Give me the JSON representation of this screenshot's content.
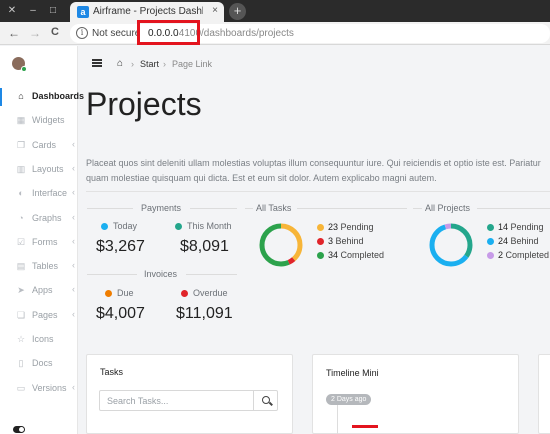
{
  "browser": {
    "tab_favicon": "a",
    "tab_title": "Airframe - Projects Dashb",
    "tab_close": "×",
    "new_tab": "+",
    "nav_back": "←",
    "nav_forward": "→",
    "nav_reload": "C",
    "info_icon": "i",
    "security": "Not secure",
    "url_host": "0.0.0.0",
    "url_path": ":4100/dashboards/projects"
  },
  "sidebar": {
    "items": [
      {
        "label": "Dashboards",
        "icon": "home-icon",
        "glyph": "⌂",
        "active": true
      },
      {
        "label": "Widgets",
        "icon": "grid-icon",
        "glyph": "▦",
        "chevron": false
      },
      {
        "label": "Cards",
        "icon": "clone-icon",
        "glyph": "❐",
        "chevron": true
      },
      {
        "label": "Layouts",
        "icon": "columns-icon",
        "glyph": "▥",
        "chevron": true
      },
      {
        "label": "Interface",
        "icon": "toggle-icon",
        "glyph": "◐",
        "chevron": true
      },
      {
        "label": "Graphs",
        "icon": "pie-icon",
        "glyph": "◔",
        "chevron": true
      },
      {
        "label": "Forms",
        "icon": "check-square-icon",
        "glyph": "☑",
        "chevron": true
      },
      {
        "label": "Tables",
        "icon": "table-icon",
        "glyph": "▤",
        "chevron": true
      },
      {
        "label": "Apps",
        "icon": "pointer-icon",
        "glyph": "➤",
        "chevron": true
      },
      {
        "label": "Pages",
        "icon": "copy-icon",
        "glyph": "❏",
        "chevron": true
      },
      {
        "label": "Icons",
        "icon": "star-icon",
        "glyph": "☆",
        "chevron": false
      },
      {
        "label": "Docs",
        "icon": "file-icon",
        "glyph": "▯",
        "chevron": false
      },
      {
        "label": "Versions",
        "icon": "folder-icon",
        "glyph": "▭",
        "chevron": true
      }
    ],
    "chevron_glyph": "‹"
  },
  "breadcrumb": {
    "home_glyph": "⌂",
    "sep": "›",
    "start": "Start",
    "page_link": "Page Link"
  },
  "page": {
    "title": "Projects",
    "description": "Placeat quos sint deleniti ullam molestias voluptas illum consequuntur iure. Qui reiciendis et optio iste est. Pariatur quam molestiae quisquam qui dicta. Est et eum sit dolor. Autem explicabo magni autem."
  },
  "payments": {
    "heading": "Payments",
    "today_label": "Today",
    "today_value": "$3,267",
    "month_label": "This Month",
    "month_value": "$8,091"
  },
  "invoices": {
    "heading": "Invoices",
    "due_label": "Due",
    "due_value": "$4,007",
    "overdue_label": "Overdue",
    "overdue_value": "$11,091"
  },
  "all_tasks": {
    "heading": "All Tasks",
    "legend": [
      {
        "count": "23",
        "label": "Pending",
        "color": "#f7b538"
      },
      {
        "count": "3",
        "label": "Behind",
        "color": "#e0242a"
      },
      {
        "count": "34",
        "label": "Completed",
        "color": "#2ca24c"
      }
    ]
  },
  "all_projects": {
    "heading": "All Projects",
    "legend": [
      {
        "count": "14",
        "label": "Pending",
        "color": "#24a68c"
      },
      {
        "count": "24",
        "label": "Behind",
        "color": "#1aaff0"
      },
      {
        "count": "2",
        "label": "Completed",
        "color": "#c79be8"
      }
    ]
  },
  "colors": {
    "today": "#1aaff0",
    "this_month": "#24a68c",
    "due": "#ef7d00",
    "overdue": "#e0242a",
    "accent": "#1e88e5"
  },
  "tasks_card": {
    "title": "Tasks",
    "search_placeholder": "Search Tasks..."
  },
  "timeline_card": {
    "title": "Timeline Mini",
    "badge": "2 Days ago"
  }
}
